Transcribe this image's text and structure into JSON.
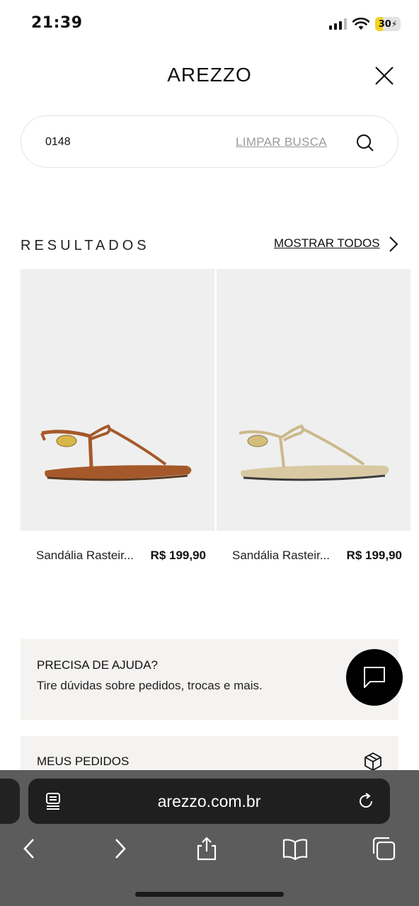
{
  "status_bar": {
    "time": "21:39",
    "battery_level": "30",
    "battery_fraction": 0.3,
    "battery_color": "#f4d21f",
    "icons": [
      "cellular-signal-icon",
      "wifi-icon",
      "battery-charging-icon"
    ]
  },
  "header": {
    "brand": "AREZZO",
    "close_icon": "close-icon"
  },
  "search": {
    "value": "0148",
    "clear_label": "LIMPAR BUSCA",
    "icon": "search-icon"
  },
  "results": {
    "title": "RESULTADOS",
    "show_all_label": "MOSTRAR TODOS",
    "products": [
      {
        "name": "Sandália Rasteir...",
        "price": "R$ 199,90",
        "color": "#a5592a"
      },
      {
        "name": "Sandália Rasteir...",
        "price": "R$ 199,90",
        "color": "#d8c9a3"
      }
    ]
  },
  "help": {
    "title": "PRECISA DE AJUDA?",
    "description": "Tire dúvidas sobre pedidos, trocas e mais.",
    "chat_icon": "chat-icon"
  },
  "orders": {
    "title": "MEUS PEDIDOS",
    "icon": "package-icon"
  },
  "browser": {
    "url": "arezzo.com.br",
    "toolbar_icons": [
      "back-icon",
      "forward-icon",
      "share-icon",
      "bookmarks-icon",
      "tabs-icon"
    ]
  },
  "colors": {
    "card_background": "#f5f3f1",
    "product_background": "#efefef",
    "browser_bar": "#5c5c5c"
  }
}
